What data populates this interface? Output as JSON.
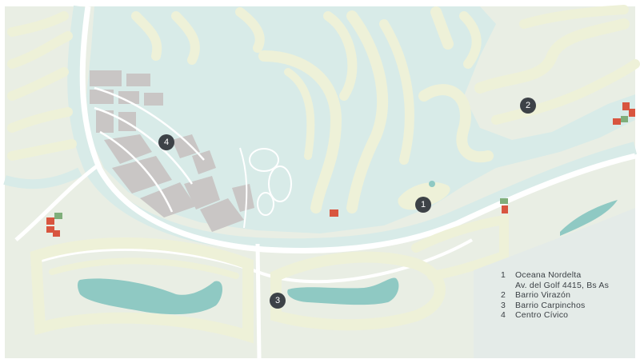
{
  "map": {
    "colors": {
      "water": "#d8ebe8",
      "land": "#e9eee4",
      "lot": "#eef1d8",
      "road": "#ffffff",
      "civic": "#c9c6c5",
      "accent": "#d8553f",
      "green_lot": "#7fae7a",
      "marker": "#3d4247",
      "lagoon": "#8fc9c3",
      "legend_panel": "#e4ebe8"
    },
    "markers": [
      {
        "label": "1"
      },
      {
        "label": "2"
      },
      {
        "label": "3"
      },
      {
        "label": "4"
      }
    ],
    "legend": [
      {
        "num": "1",
        "text": "Oceana Nordelta"
      },
      {
        "num": "",
        "text": "Av. del Golf 4415, Bs As"
      },
      {
        "num": "2",
        "text": "Barrio Virazón"
      },
      {
        "num": "3",
        "text": "Barrio Carpinchos"
      },
      {
        "num": "4",
        "text": "Centro Cívico"
      }
    ]
  }
}
